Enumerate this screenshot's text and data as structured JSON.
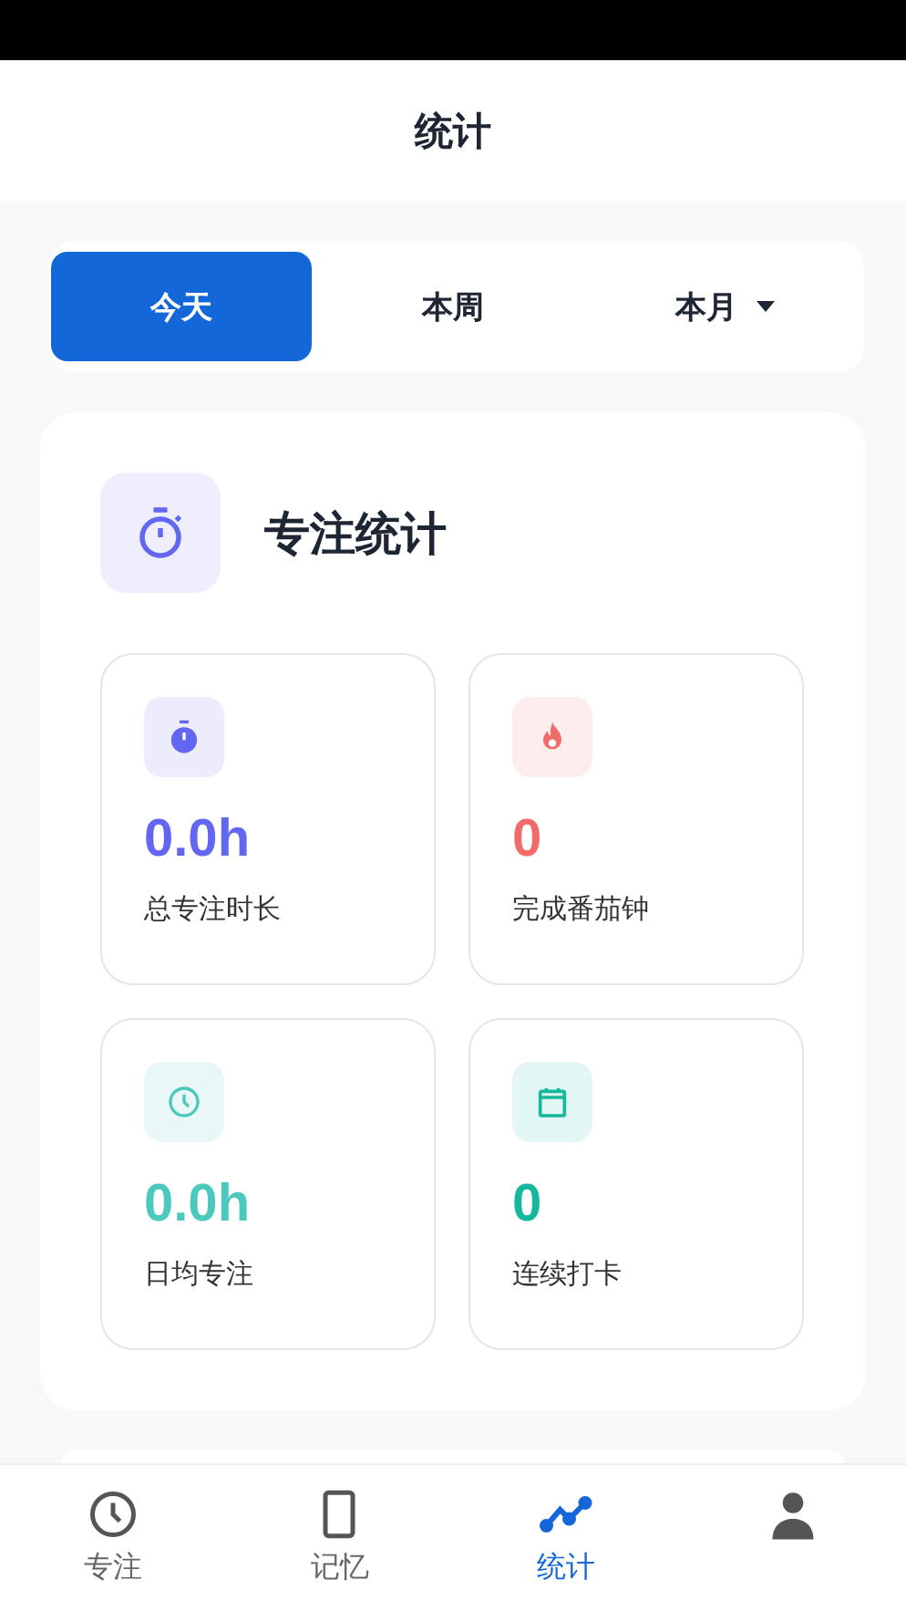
{
  "header": {
    "title": "统计"
  },
  "tabs": [
    {
      "label": "今天",
      "selected": true,
      "kind": "plain"
    },
    {
      "label": "本周",
      "selected": false,
      "kind": "plain"
    },
    {
      "label": "本月",
      "selected": false,
      "kind": "dropdown"
    }
  ],
  "focus_card": {
    "title": "专注统计",
    "stats": [
      {
        "value": "0.0h",
        "label": "总专注时长",
        "kind": "stopwatch",
        "color": "#6366f1"
      },
      {
        "value": "0",
        "label": "完成番茄钟",
        "kind": "flame",
        "color": "#f26b6b"
      },
      {
        "value": "0.0h",
        "label": "日均专注",
        "kind": "clock",
        "color": "#4cc9bd"
      },
      {
        "value": "0",
        "label": "连续打卡",
        "kind": "calendar",
        "color": "#14b89c"
      }
    ]
  },
  "bottom_nav": [
    {
      "label": "专注",
      "kind": "clock",
      "selected": false
    },
    {
      "label": "记忆",
      "kind": "tablet",
      "selected": false
    },
    {
      "label": "统计",
      "kind": "chart",
      "selected": true
    },
    {
      "kind": "person",
      "selected": false
    }
  ]
}
